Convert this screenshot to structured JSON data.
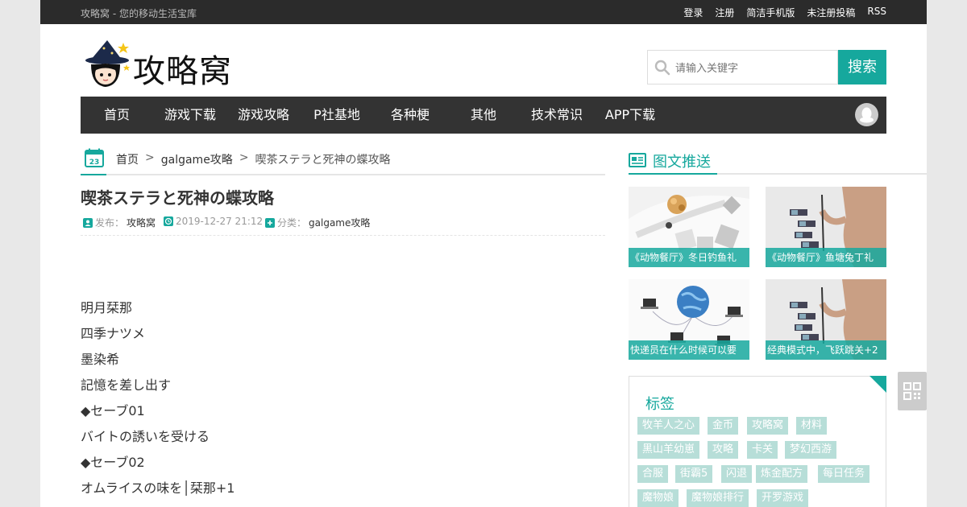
{
  "topbar": {
    "slogan": "攻略窝 - 您的移动生活宝库",
    "links": [
      "登录",
      "注册",
      "简洁手机版",
      "未注册投稿",
      "RSS"
    ]
  },
  "logo": {
    "text": "攻略窝"
  },
  "search": {
    "placeholder": "请输入关键字",
    "button": "搜索"
  },
  "nav": {
    "items": [
      "首页",
      "游戏下载",
      "游戏攻略",
      "P社基地",
      "各种梗",
      "其他",
      "技术常识",
      "APP下载"
    ]
  },
  "breadcrumb": {
    "home": "首页",
    "category": "galgame攻略",
    "current": "喫茶ステラと死神の蝶攻略",
    "sep": ">"
  },
  "article": {
    "title": "喫茶ステラと死神の蝶攻略",
    "meta": {
      "author_label": "发布：",
      "author": "攻略窝",
      "date": "2019-12-27 21:12",
      "category_label": "分类：",
      "category": "galgame攻略"
    },
    "paragraphs": [
      "明月栞那",
      "四季ナツメ",
      "墨染希",
      "記憶を差し出す",
      "◆セーブ01",
      "バイトの誘いを受ける",
      "◆セーブ02",
      "オムライスの味を│栞那+1"
    ]
  },
  "sidebar": {
    "title": "图文推送",
    "posts": [
      {
        "caption": "《动物餐厅》冬日钓鱼礼"
      },
      {
        "caption": "《动物餐厅》鱼塘兔丁礼"
      },
      {
        "caption": "快递员在什么时候可以要"
      },
      {
        "caption": "经典模式中，飞跃跳关+2"
      }
    ],
    "tags_title": "标签",
    "tags": [
      "牧羊人之心",
      "金币",
      "攻略窝",
      "材料",
      "黑山羊幼崽",
      "攻略",
      "卡关",
      "梦幻西游",
      "合服",
      "街霸5",
      "闪退",
      "炼金配方",
      "每日任务",
      "魔物娘",
      "魔物娘排行",
      "开罗游戏"
    ]
  },
  "colors": {
    "accent": "#16a89d",
    "topbar": "#2b2b2b",
    "nav": "#333333",
    "tag": "#b7ded8"
  }
}
